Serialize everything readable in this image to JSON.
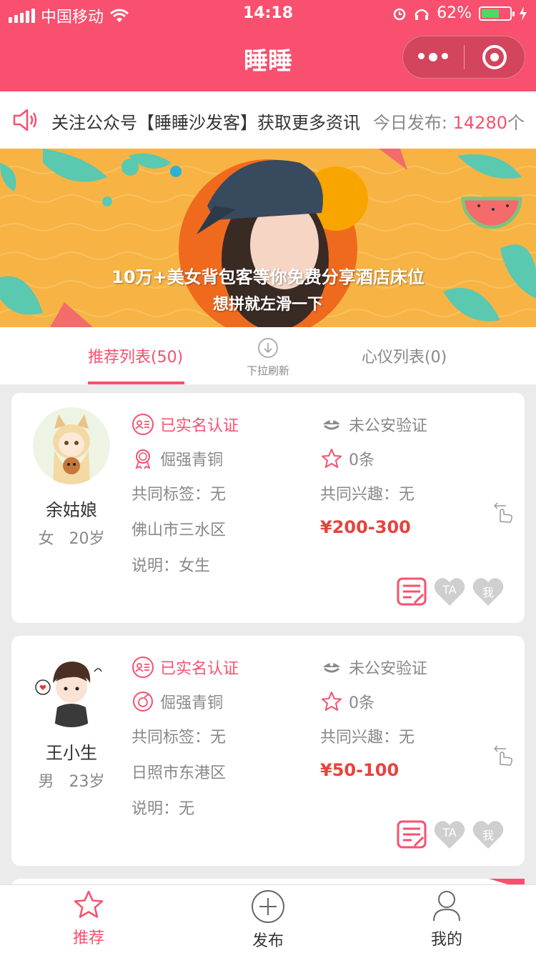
{
  "status_bar": {
    "carrier": "中国移动",
    "time": "14:18",
    "battery": "62%"
  },
  "nav": {
    "title": "睡睡"
  },
  "notice": {
    "text": "关注公众号【睡睡沙发客】获取更多资讯",
    "count_label": "今日发布:",
    "count_value": "14280",
    "count_unit": "个"
  },
  "banner": {
    "line1": "10万+美女背包客等你免费分享酒店床位",
    "line2": "想拼就左滑一下"
  },
  "tabs": {
    "recommend": "推荐列表(50)",
    "refresh": "下拉刷新",
    "heart": "心仪列表(0)"
  },
  "cards": [
    {
      "name": "余姑娘",
      "gender": "女",
      "age": "20岁",
      "verified": "已实名认证",
      "police": "未公安验证",
      "level": "倔强青铜",
      "stars": "0条",
      "common_tags": "共同标签：无",
      "common_interests": "共同兴趣：无",
      "location": "佛山市三水区",
      "price": "¥200-300",
      "note": "说明：女生",
      "btn_ta": "TA",
      "btn_me": "我"
    },
    {
      "name": "王小生",
      "gender": "男",
      "age": "23岁",
      "verified": "已实名认证",
      "police": "未公安验证",
      "level": "倔强青铜",
      "stars": "0条",
      "common_tags": "共同标签：无",
      "common_interests": "共同兴趣：无",
      "location": "日照市东港区",
      "price": "¥50-100",
      "note": "说明：无",
      "btn_ta": "TA",
      "btn_me": "我"
    }
  ],
  "tabbar": {
    "recommend": "推荐",
    "publish": "发布",
    "mine": "我的"
  },
  "colors": {
    "accent": "#f8506e",
    "price": "#e9423d",
    "muted": "#888888"
  }
}
